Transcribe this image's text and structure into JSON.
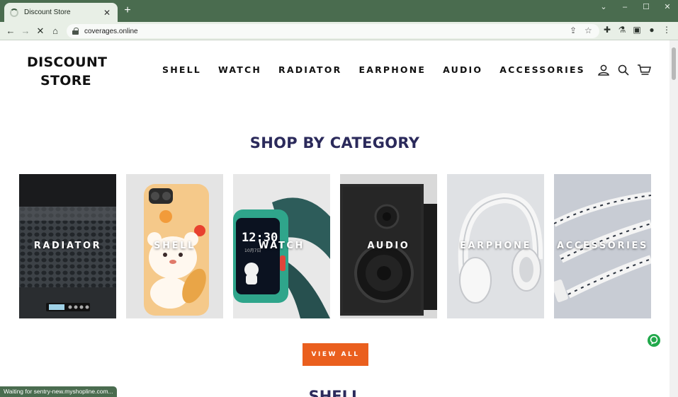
{
  "browser": {
    "tab_title": "Discount Store",
    "tab_close_icon": "✕",
    "new_tab_icon": "+",
    "window_controls": [
      "⌄",
      "–",
      "☐",
      "✕"
    ],
    "url": "coverages.online",
    "status_text": "Waiting for sentry-new.myshopline.com..."
  },
  "header": {
    "logo_line1": "DISCOUNT",
    "logo_line2": "STORE",
    "nav": [
      "SHELL",
      "WATCH",
      "RADIATOR",
      "EARPHONE",
      "AUDIO",
      "ACCESSORIES"
    ],
    "icons": [
      "account-icon",
      "search-icon",
      "cart-icon"
    ]
  },
  "section": {
    "title": "SHOP BY CATEGORY",
    "view_all_label": "VIEW ALL",
    "next_title": "SHELL"
  },
  "categories": [
    {
      "label": "RADIATOR"
    },
    {
      "label": "SHELL"
    },
    {
      "label": "WATCH"
    },
    {
      "label": "AUDIO"
    },
    {
      "label": "EARPHONE"
    },
    {
      "label": "ACCESSORIES"
    }
  ],
  "colors": {
    "accent_orange": "#ea5f1e",
    "title_navy": "#2b2a5b",
    "chrome_green": "#4a6c4f"
  }
}
